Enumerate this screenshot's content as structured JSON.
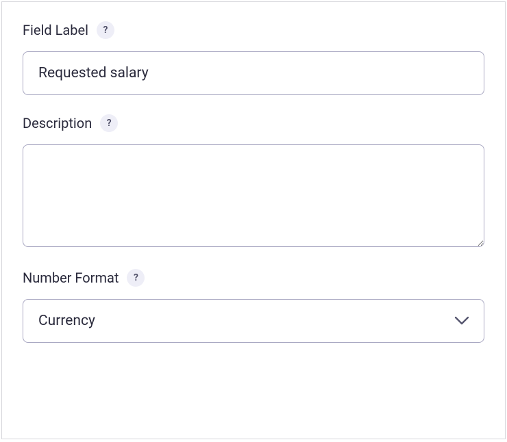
{
  "form": {
    "fieldLabel": {
      "label": "Field Label",
      "value": "Requested salary"
    },
    "description": {
      "label": "Description",
      "value": ""
    },
    "numberFormat": {
      "label": "Number Format",
      "selected": "Currency"
    }
  },
  "icons": {
    "help": "?"
  }
}
